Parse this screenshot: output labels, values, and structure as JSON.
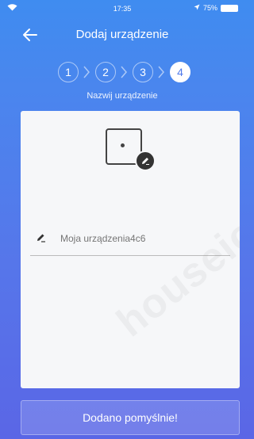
{
  "status_bar": {
    "time": "17:35",
    "battery": "75%"
  },
  "header": {
    "title": "Dodaj urządzenie"
  },
  "steps": {
    "labels": [
      "1",
      "2",
      "3",
      "4"
    ],
    "active": 4,
    "caption": "Nazwij urządzenie"
  },
  "device_name": {
    "value": "",
    "placeholder": "Moja urządzenia4c6"
  },
  "watermark": "houseio",
  "bottom_button": {
    "label": "Dodano pomyślnie!"
  },
  "colors": {
    "gradient_top": "#3f8cf0",
    "gradient_bottom": "#5a66e6",
    "card": "#f6f7f9",
    "active_step_text": "#4f79ea"
  }
}
